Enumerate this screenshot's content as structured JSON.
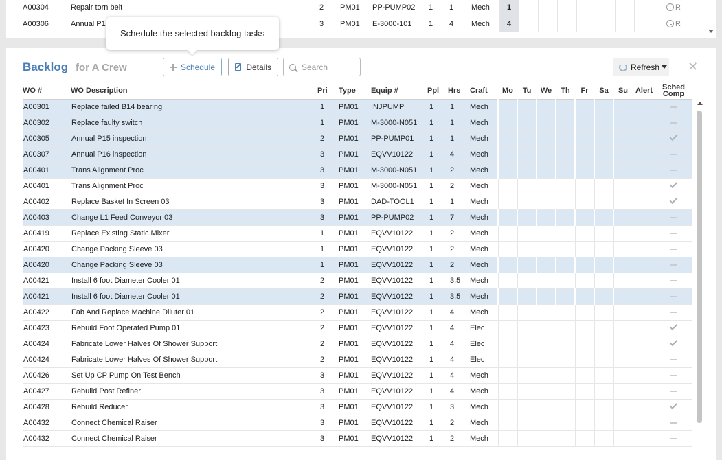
{
  "tooltip": {
    "text": "Schedule the selected backlog tasks"
  },
  "scheduled": {
    "rows": [
      {
        "wo": "A00304",
        "desc": "Repair torn belt",
        "pri": "2",
        "type": "PM01",
        "equip": "PP-PUMP02",
        "ppl": "1",
        "hrs": "1",
        "craft": "Mech",
        "days": [
          "1",
          "",
          "",
          "",
          "",
          "",
          ""
        ],
        "status": "R"
      },
      {
        "wo": "A00306",
        "desc": "Annual P1",
        "pri": "3",
        "type": "PM01",
        "equip": "E-3000-101",
        "ppl": "1",
        "hrs": "4",
        "craft": "Mech",
        "days": [
          "4",
          "",
          "",
          "",
          "",
          "",
          ""
        ],
        "status": "R"
      }
    ]
  },
  "panel": {
    "title": "Backlog",
    "subtitle": "for A Crew",
    "schedule_label": "Schedule",
    "details_label": "Details",
    "search_placeholder": "Search",
    "refresh_label": "Refresh",
    "close_glyph": "✕"
  },
  "columns": {
    "wo": "WO #",
    "desc": "WO Description",
    "pri": "Pri",
    "type": "Type",
    "equip": "Equip #",
    "ppl": "Ppl",
    "hrs": "Hrs",
    "craft": "Craft",
    "mo": "Mo",
    "tu": "Tu",
    "we": "We",
    "th": "Th",
    "fr": "Fr",
    "sa": "Sa",
    "su": "Su",
    "alert": "Alert",
    "sched_comp_1": "Sched",
    "sched_comp_2": "Comp"
  },
  "rows": [
    {
      "wo": "A00301",
      "desc": "Replace failed B14 bearing",
      "pri": "1",
      "type": "PM01",
      "equip": "INJPUMP",
      "ppl": "1",
      "hrs": "1",
      "craft": "Mech",
      "selected": true,
      "comp": "dash"
    },
    {
      "wo": "A00302",
      "desc": "Replace faulty switch",
      "pri": "1",
      "type": "PM01",
      "equip": "M-3000-N051",
      "ppl": "1",
      "hrs": "1",
      "craft": "Mech",
      "selected": true,
      "comp": "dash"
    },
    {
      "wo": "A00305",
      "desc": "Annual P15 inspection",
      "pri": "2",
      "type": "PM01",
      "equip": "PP-PUMP01",
      "ppl": "1",
      "hrs": "1",
      "craft": "Mech",
      "selected": true,
      "comp": "check"
    },
    {
      "wo": "A00307",
      "desc": "Annual P16 inspection",
      "pri": "3",
      "type": "PM01",
      "equip": "EQVV10122",
      "ppl": "1",
      "hrs": "4",
      "craft": "Mech",
      "selected": true,
      "comp": "dash"
    },
    {
      "wo": "A00401",
      "desc": "Trans Alignment Proc",
      "pri": "3",
      "type": "PM01",
      "equip": "M-3000-N051",
      "ppl": "1",
      "hrs": "2",
      "craft": "Mech",
      "selected": true,
      "comp": "dash"
    },
    {
      "wo": "A00401",
      "desc": "Trans Alignment Proc",
      "pri": "3",
      "type": "PM01",
      "equip": "M-3000-N051",
      "ppl": "1",
      "hrs": "2",
      "craft": "Mech",
      "selected": false,
      "comp": "check"
    },
    {
      "wo": "A00402",
      "desc": "Replace Basket In Screen 03",
      "pri": "3",
      "type": "PM01",
      "equip": "DAD-TOOL1",
      "ppl": "1",
      "hrs": "1",
      "craft": "Mech",
      "selected": false,
      "comp": "check"
    },
    {
      "wo": "A00403",
      "desc": "Change L1 Feed Conveyor 03",
      "pri": "3",
      "type": "PM01",
      "equip": "PP-PUMP02",
      "ppl": "1",
      "hrs": "7",
      "craft": "Mech",
      "selected": true,
      "comp": "dash"
    },
    {
      "wo": "A00419",
      "desc": "Replace Existing Static Mixer",
      "pri": "1",
      "type": "PM01",
      "equip": "EQVV10122",
      "ppl": "1",
      "hrs": "2",
      "craft": "Mech",
      "selected": false,
      "comp": "dash"
    },
    {
      "wo": "A00420",
      "desc": "Change Packing Sleeve 03",
      "pri": "1",
      "type": "PM01",
      "equip": "EQVV10122",
      "ppl": "1",
      "hrs": "2",
      "craft": "Mech",
      "selected": false,
      "comp": "dash"
    },
    {
      "wo": "A00420",
      "desc": "Change Packing Sleeve 03",
      "pri": "1",
      "type": "PM01",
      "equip": "EQVV10122",
      "ppl": "1",
      "hrs": "2",
      "craft": "Mech",
      "selected": true,
      "comp": "dash"
    },
    {
      "wo": "A00421",
      "desc": "Install 6 foot Diameter Cooler 01",
      "pri": "2",
      "type": "PM01",
      "equip": "EQVV10122",
      "ppl": "1",
      "hrs": "3.5",
      "craft": "Mech",
      "selected": false,
      "comp": "dash"
    },
    {
      "wo": "A00421",
      "desc": "Install 6 foot Diameter Cooler 01",
      "pri": "2",
      "type": "PM01",
      "equip": "EQVV10122",
      "ppl": "1",
      "hrs": "3.5",
      "craft": "Mech",
      "selected": true,
      "comp": "dash"
    },
    {
      "wo": "A00422",
      "desc": "Fab And Replace Machine Diluter 01",
      "pri": "2",
      "type": "PM01",
      "equip": "EQVV10122",
      "ppl": "1",
      "hrs": "4",
      "craft": "Mech",
      "selected": false,
      "comp": "dash"
    },
    {
      "wo": "A00423",
      "desc": "Rebuild Foot Operated Pump 01",
      "pri": "2",
      "type": "PM01",
      "equip": "EQVV10122",
      "ppl": "1",
      "hrs": "4",
      "craft": "Elec",
      "selected": false,
      "comp": "check"
    },
    {
      "wo": "A00424",
      "desc": "Fabricate Lower Halves Of Shower Support",
      "pri": "2",
      "type": "PM01",
      "equip": "EQVV10122",
      "ppl": "1",
      "hrs": "4",
      "craft": "Elec",
      "selected": false,
      "comp": "check"
    },
    {
      "wo": "A00424",
      "desc": "Fabricate Lower Halves Of Shower Support",
      "pri": "2",
      "type": "PM01",
      "equip": "EQVV10122",
      "ppl": "1",
      "hrs": "4",
      "craft": "Elec",
      "selected": false,
      "comp": "dash"
    },
    {
      "wo": "A00426",
      "desc": "Set Up CP Pump On Test Bench",
      "pri": "3",
      "type": "PM01",
      "equip": "EQVV10122",
      "ppl": "1",
      "hrs": "4",
      "craft": "Mech",
      "selected": false,
      "comp": "dash"
    },
    {
      "wo": "A00427",
      "desc": "Rebuild Post Refiner",
      "pri": "3",
      "type": "PM01",
      "equip": "EQVV10122",
      "ppl": "1",
      "hrs": "4",
      "craft": "Mech",
      "selected": false,
      "comp": "dash"
    },
    {
      "wo": "A00428",
      "desc": "Rebuild Reducer",
      "pri": "3",
      "type": "PM01",
      "equip": "EQVV10122",
      "ppl": "1",
      "hrs": "3",
      "craft": "Mech",
      "selected": false,
      "comp": "check"
    },
    {
      "wo": "A00432",
      "desc": "Connect Chemical Raiser",
      "pri": "3",
      "type": "PM01",
      "equip": "EQVV10122",
      "ppl": "1",
      "hrs": "2",
      "craft": "Mech",
      "selected": false,
      "comp": "dash"
    },
    {
      "wo": "A00432",
      "desc": "Connect Chemical Raiser",
      "pri": "3",
      "type": "PM01",
      "equip": "EQVV10122",
      "ppl": "1",
      "hrs": "2",
      "craft": "Mech",
      "selected": false,
      "comp": "dash"
    }
  ]
}
